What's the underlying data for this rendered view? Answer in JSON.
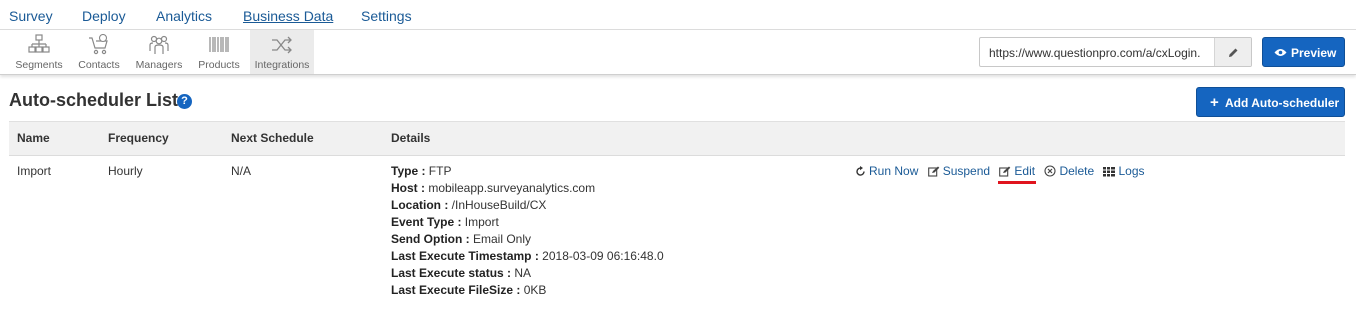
{
  "topnav": {
    "items": [
      {
        "label": "Survey"
      },
      {
        "label": "Deploy"
      },
      {
        "label": "Analytics"
      },
      {
        "label": "Business Data",
        "active": true
      },
      {
        "label": "Settings"
      }
    ]
  },
  "subnav": {
    "tabs": [
      {
        "label": "Segments",
        "icon": "org-chart-icon"
      },
      {
        "label": "Contacts",
        "icon": "cart-icon"
      },
      {
        "label": "Managers",
        "icon": "users-icon"
      },
      {
        "label": "Products",
        "icon": "barcode-icon"
      },
      {
        "label": "Integrations",
        "icon": "shuffle-icon",
        "active": true
      }
    ],
    "url_value": "https://www.questionpro.com/a/cxLogin.",
    "preview_label": "Preview"
  },
  "page": {
    "title": "Auto-scheduler List",
    "add_button_label": "Add Auto-scheduler"
  },
  "table": {
    "columns": [
      "Name",
      "Frequency",
      "Next Schedule",
      "Details"
    ],
    "rows": [
      {
        "name": "Import",
        "frequency": "Hourly",
        "next_schedule": "N/A",
        "details": [
          {
            "key": "Type :",
            "value": " FTP"
          },
          {
            "key": "Host :",
            "value": " mobileapp.surveyanalytics.com"
          },
          {
            "key": "Location :",
            "value": " /InHouseBuild/CX"
          },
          {
            "key": "Event Type :",
            "value": " Import"
          },
          {
            "key": "Send Option :",
            "value": " Email Only"
          },
          {
            "key": "Last Execute Timestamp :",
            "value": " 2018-03-09 06:16:48.0"
          },
          {
            "key": "Last Execute status :",
            "value": " NA"
          },
          {
            "key": "Last Execute FileSize :",
            "value": " 0KB"
          }
        ],
        "actions": {
          "run_now": "Run Now",
          "suspend": "Suspend",
          "edit": "Edit",
          "delete": "Delete",
          "logs": "Logs"
        }
      }
    ]
  },
  "colors": {
    "primary": "#1565c0",
    "link": "#1a5a96",
    "highlight": "#e0141e"
  }
}
